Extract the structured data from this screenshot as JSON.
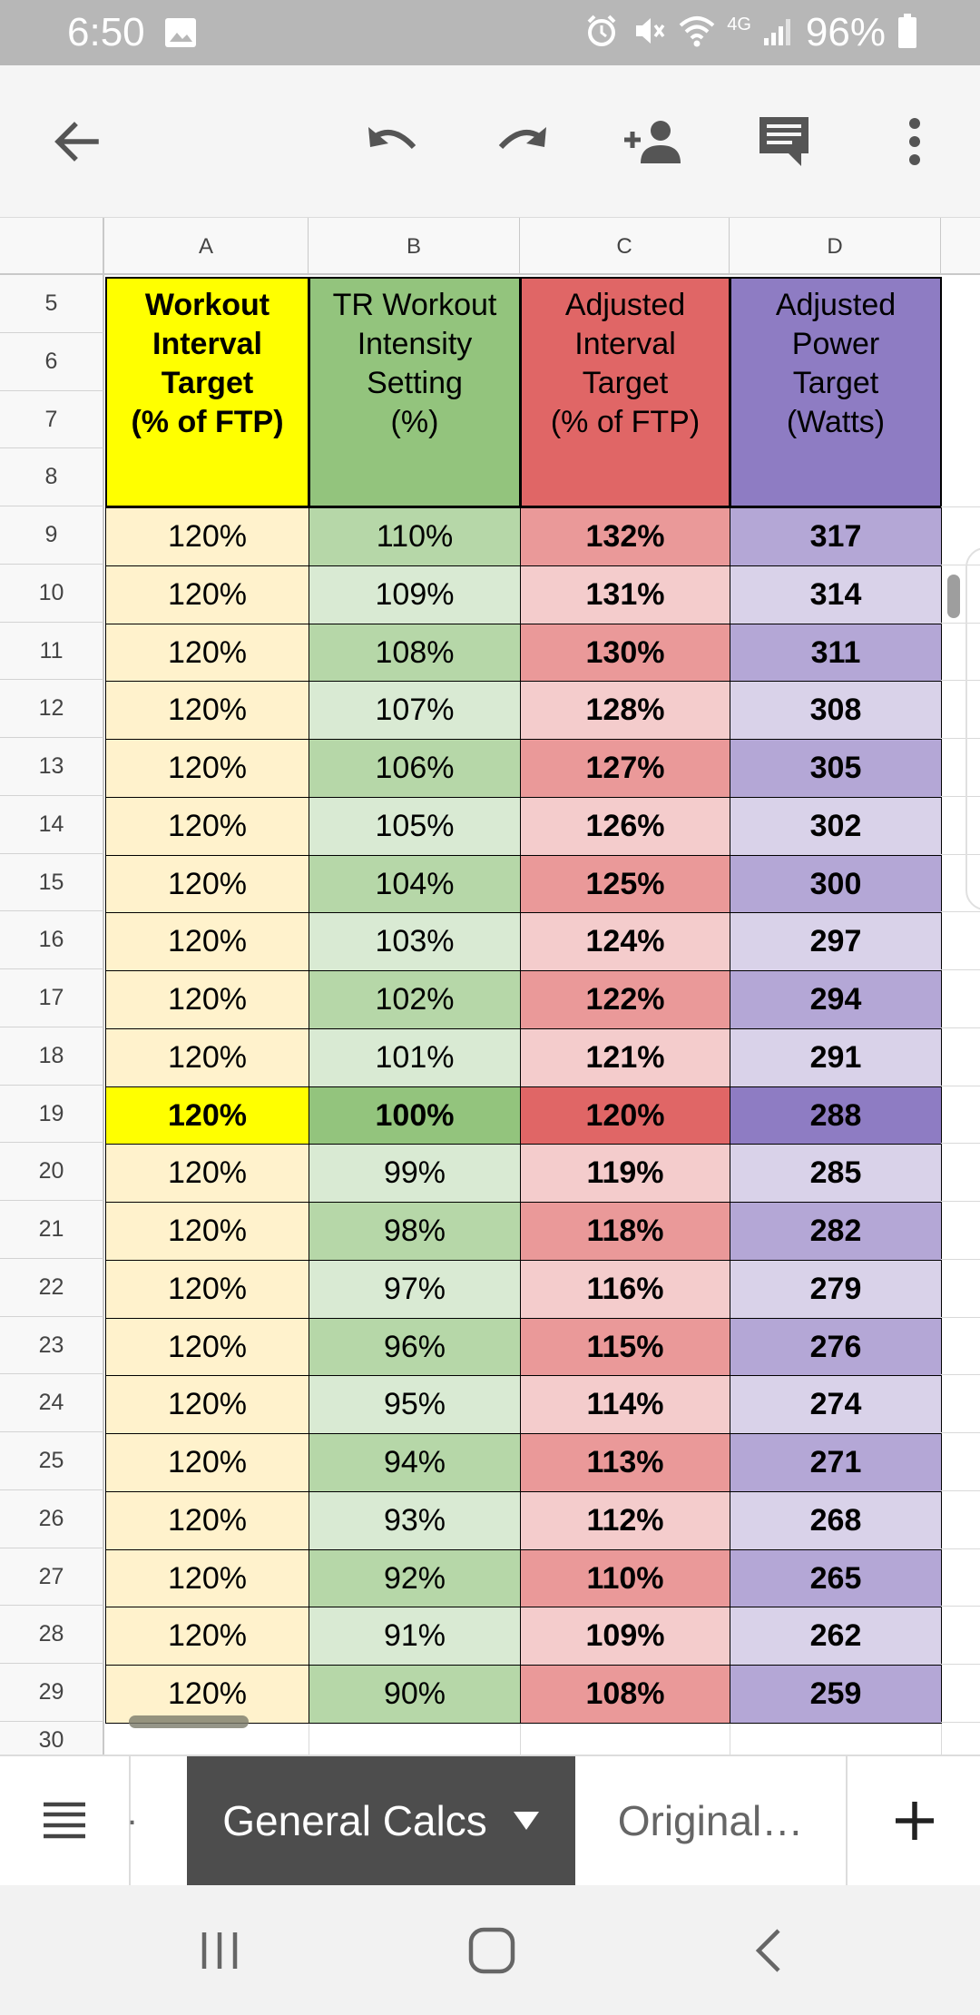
{
  "status_bar": {
    "time": "6:50",
    "battery": "96%",
    "network": "4G"
  },
  "toolbar": {
    "icons": [
      "back-arrow-icon",
      "undo-icon",
      "redo-icon",
      "add-person-icon",
      "comment-icon",
      "more-vert-icon"
    ]
  },
  "sheet": {
    "columns": [
      "A",
      "B",
      "C",
      "D"
    ],
    "header_row_numbers": [
      "5",
      "6",
      "7",
      "8"
    ],
    "headers": {
      "a": "Workout\nInterval\nTarget\n(% of FTP)",
      "b": "TR Workout\nIntensity\nSetting\n(%)",
      "c": "Adjusted\nInterval\nTarget\n(% of FTP)",
      "d": "Adjusted\nPower\nTarget\n(Watts)"
    },
    "rows": [
      {
        "num": "9",
        "a": "120%",
        "b": "110%",
        "c": "132%",
        "d": "317"
      },
      {
        "num": "10",
        "a": "120%",
        "b": "109%",
        "c": "131%",
        "d": "314"
      },
      {
        "num": "11",
        "a": "120%",
        "b": "108%",
        "c": "130%",
        "d": "311"
      },
      {
        "num": "12",
        "a": "120%",
        "b": "107%",
        "c": "128%",
        "d": "308"
      },
      {
        "num": "13",
        "a": "120%",
        "b": "106%",
        "c": "127%",
        "d": "305"
      },
      {
        "num": "14",
        "a": "120%",
        "b": "105%",
        "c": "126%",
        "d": "302"
      },
      {
        "num": "15",
        "a": "120%",
        "b": "104%",
        "c": "125%",
        "d": "300"
      },
      {
        "num": "16",
        "a": "120%",
        "b": "103%",
        "c": "124%",
        "d": "297"
      },
      {
        "num": "17",
        "a": "120%",
        "b": "102%",
        "c": "122%",
        "d": "294"
      },
      {
        "num": "18",
        "a": "120%",
        "b": "101%",
        "c": "121%",
        "d": "291"
      },
      {
        "num": "19",
        "a": "120%",
        "b": "100%",
        "c": "120%",
        "d": "288"
      },
      {
        "num": "20",
        "a": "120%",
        "b": "99%",
        "c": "119%",
        "d": "285"
      },
      {
        "num": "21",
        "a": "120%",
        "b": "98%",
        "c": "118%",
        "d": "282"
      },
      {
        "num": "22",
        "a": "120%",
        "b": "97%",
        "c": "116%",
        "d": "279"
      },
      {
        "num": "23",
        "a": "120%",
        "b": "96%",
        "c": "115%",
        "d": "276"
      },
      {
        "num": "24",
        "a": "120%",
        "b": "95%",
        "c": "114%",
        "d": "274"
      },
      {
        "num": "25",
        "a": "120%",
        "b": "94%",
        "c": "113%",
        "d": "271"
      },
      {
        "num": "26",
        "a": "120%",
        "b": "93%",
        "c": "112%",
        "d": "268"
      },
      {
        "num": "27",
        "a": "120%",
        "b": "92%",
        "c": "110%",
        "d": "265"
      },
      {
        "num": "28",
        "a": "120%",
        "b": "91%",
        "c": "109%",
        "d": "262"
      },
      {
        "num": "29",
        "a": "120%",
        "b": "90%",
        "c": "108%",
        "d": "259"
      }
    ],
    "partial_row_num": "30",
    "highlight_row": "19",
    "colors": {
      "a_header": "#ffff00",
      "a_cell": "#fff2cc",
      "b_header": "#93c47d",
      "b_dark": "#b6d7a8",
      "b_light": "#d9ead3",
      "c_header": "#e06666",
      "c_dark": "#ea9999",
      "c_light": "#f4cccc",
      "d_header": "#8e7cc3",
      "d_dark": "#b4a7d6",
      "d_light": "#d9d2e9"
    }
  },
  "tabs": {
    "prev_fragment": ".",
    "active": "General Calcs",
    "other": "Original…"
  },
  "nav": {
    "icons": [
      "recents-icon",
      "home-icon",
      "back-icon"
    ]
  }
}
